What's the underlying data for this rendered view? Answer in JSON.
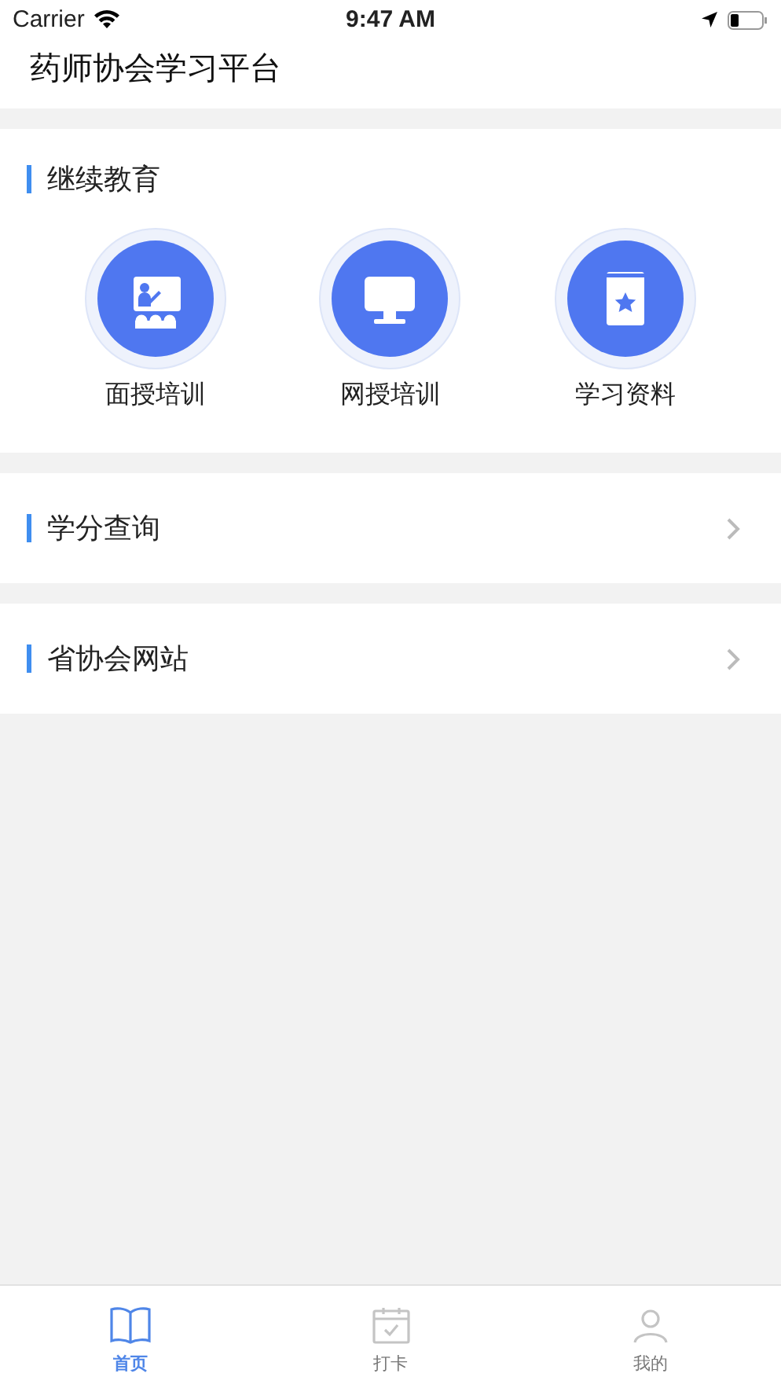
{
  "status_bar": {
    "carrier": "Carrier",
    "time": "9:47 AM"
  },
  "header": {
    "title": "药师协会学习平台"
  },
  "section": {
    "title": "继续教育",
    "items": [
      {
        "kind": "classroom",
        "label": "面授培训"
      },
      {
        "kind": "monitor",
        "label": "网授培训"
      },
      {
        "kind": "book",
        "label": "学习资料"
      }
    ]
  },
  "rows": [
    {
      "label": "学分查询"
    },
    {
      "label": "省协会网站"
    }
  ],
  "tabs": [
    {
      "kind": "book",
      "label": "首页",
      "selected": true
    },
    {
      "kind": "calendar",
      "label": "打卡",
      "selected": false
    },
    {
      "kind": "person",
      "label": "我的",
      "selected": false
    }
  ]
}
